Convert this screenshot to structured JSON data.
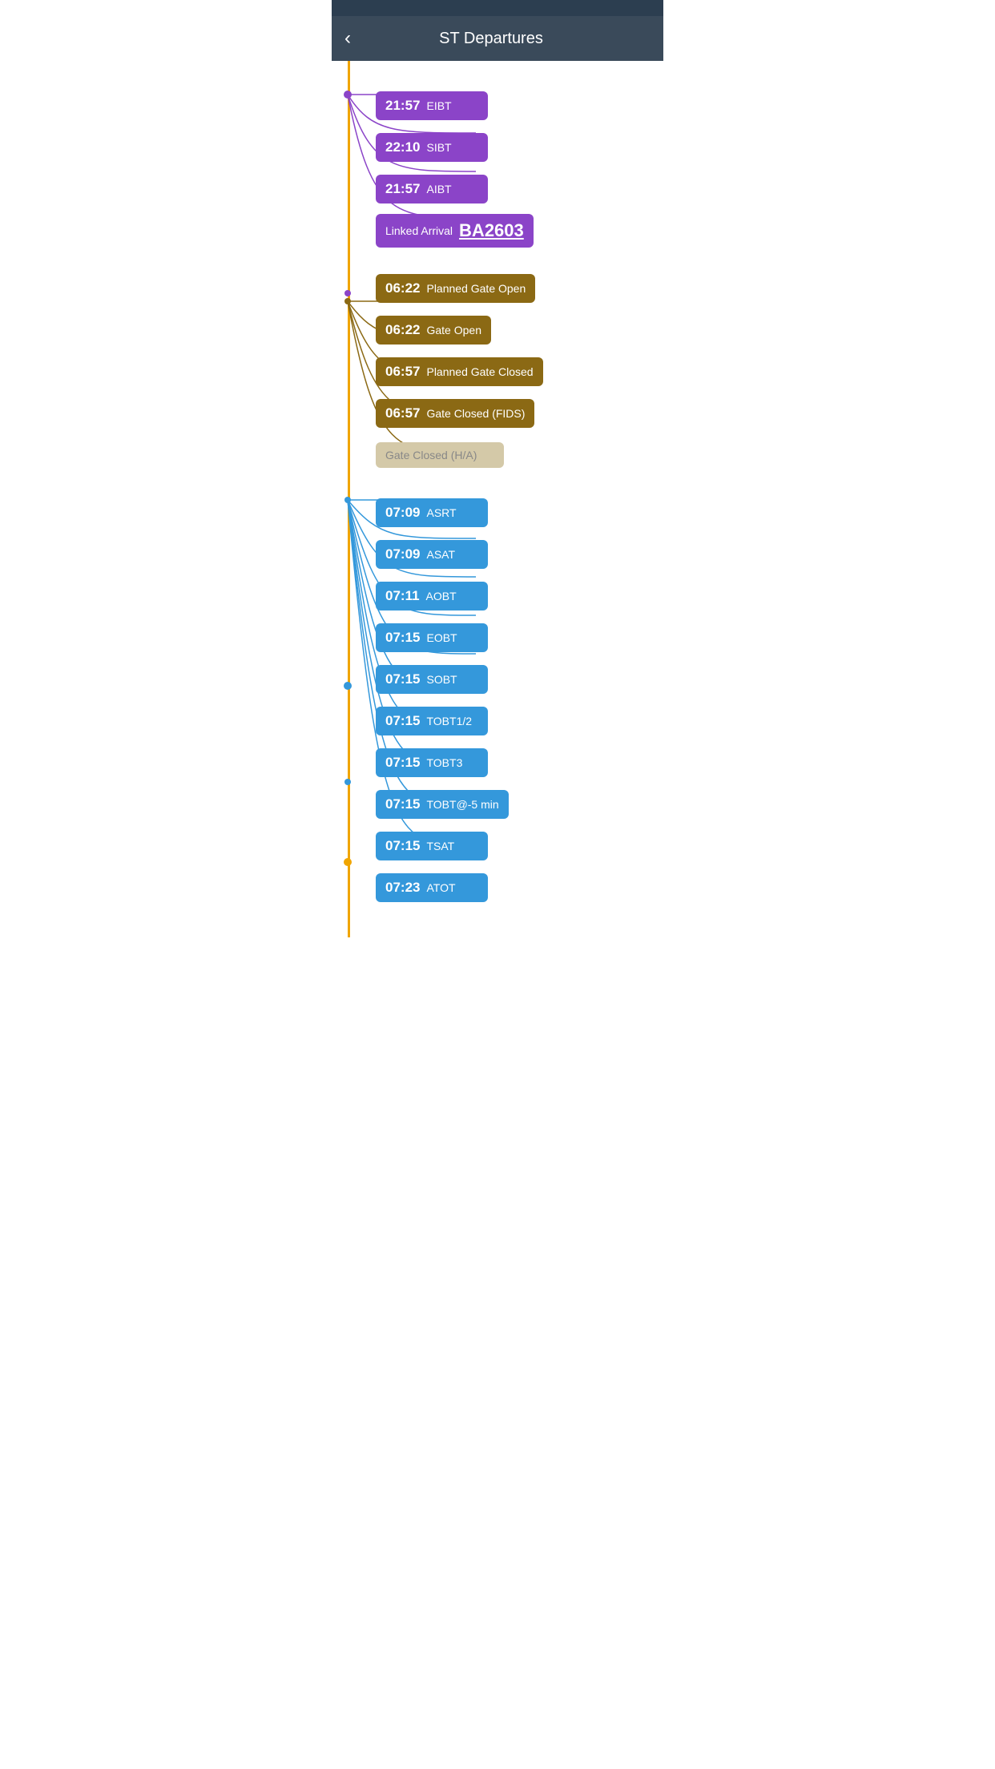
{
  "header": {
    "title": "ST Departures",
    "back_label": "‹"
  },
  "items": [
    {
      "time": "21:57",
      "label": "EIBT",
      "type": "purple",
      "group": "arrival"
    },
    {
      "time": "22:10",
      "label": "SIBT",
      "type": "purple",
      "group": "arrival"
    },
    {
      "time": "21:57",
      "label": "AIBT",
      "type": "purple",
      "group": "arrival"
    },
    {
      "time": "",
      "label": "Linked Arrival",
      "code": "BA2603",
      "type": "linked",
      "group": "arrival"
    },
    {
      "time": "06:22",
      "label": "Planned Gate Open",
      "type": "brown",
      "group": "gate"
    },
    {
      "time": "06:22",
      "label": "Gate Open",
      "type": "brown",
      "group": "gate"
    },
    {
      "time": "06:57",
      "label": "Planned Gate Closed",
      "type": "brown",
      "group": "gate"
    },
    {
      "time": "06:57",
      "label": "Gate Closed (FIDS)",
      "type": "brown",
      "group": "gate"
    },
    {
      "time": "",
      "label": "Gate Closed (H/A)",
      "type": "light",
      "group": "gate"
    },
    {
      "time": "07:09",
      "label": "ASRT",
      "type": "blue",
      "group": "departure"
    },
    {
      "time": "07:09",
      "label": "ASAT",
      "type": "blue",
      "group": "departure"
    },
    {
      "time": "07:11",
      "label": "AOBT",
      "type": "blue",
      "group": "departure"
    },
    {
      "time": "07:15",
      "label": "EOBT",
      "type": "blue",
      "group": "departure"
    },
    {
      "time": "07:15",
      "label": "SOBT",
      "type": "blue",
      "group": "departure"
    },
    {
      "time": "07:15",
      "label": "TOBT1/2",
      "type": "blue",
      "group": "departure"
    },
    {
      "time": "07:15",
      "label": "TOBT3",
      "type": "blue",
      "group": "departure"
    },
    {
      "time": "07:15",
      "label": "TOBT@-5 min",
      "type": "blue",
      "group": "departure"
    },
    {
      "time": "07:15",
      "label": "TSAT",
      "type": "blue",
      "group": "departure"
    },
    {
      "time": "07:23",
      "label": "ATOT",
      "type": "blue",
      "group": "departure"
    }
  ],
  "colors": {
    "purple": "#8b44c8",
    "brown": "#8B6914",
    "blue": "#3498db",
    "light": "#d4c9a8",
    "gold": "#f0a500",
    "header_bg": "#3a4a5a"
  }
}
